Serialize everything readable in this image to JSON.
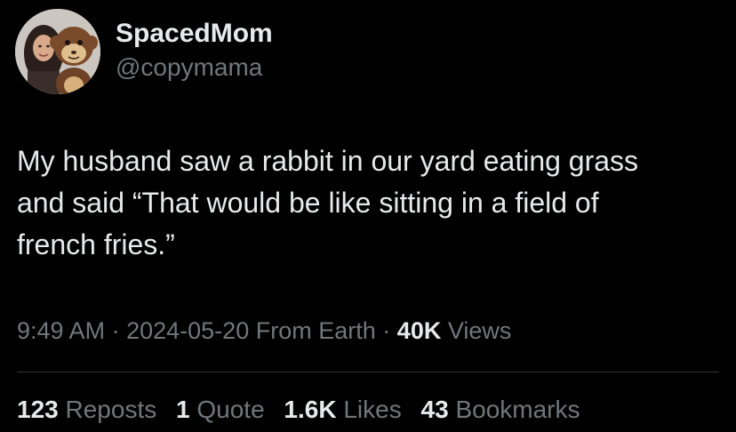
{
  "author": {
    "display_name": "SpacedMom",
    "handle": "@copymama"
  },
  "tweet": {
    "text": "My husband saw a rabbit in our yard eating grass\nand said “That would be like sitting in a field of\nfrench fries.”"
  },
  "meta": {
    "time": "9:49 AM",
    "separator": "·",
    "date": "2024-05-20",
    "location": "From Earth",
    "views_count": "40K",
    "views_label": "Views"
  },
  "stats": [
    {
      "count": "123",
      "label": "Reposts"
    },
    {
      "count": "1",
      "label": "Quote"
    },
    {
      "count": "1.6K",
      "label": "Likes"
    },
    {
      "count": "43",
      "label": "Bookmarks"
    }
  ],
  "colors": {
    "background": "#000000",
    "primary_text": "#e7e9ea",
    "secondary_text": "#71767b",
    "divider": "#2f3336"
  }
}
